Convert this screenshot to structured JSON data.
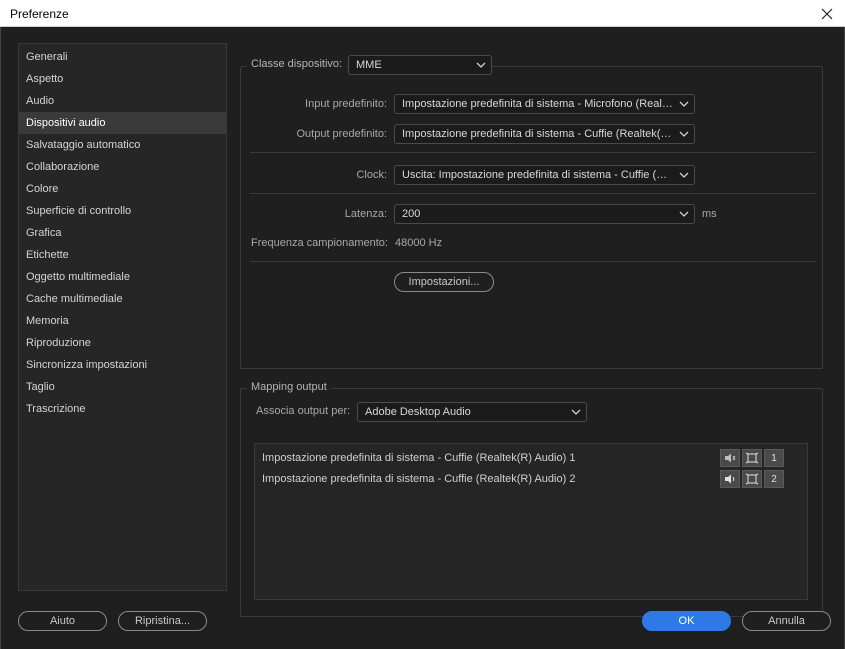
{
  "window": {
    "title": "Preferenze"
  },
  "sidebar": {
    "items": [
      {
        "label": "Generali"
      },
      {
        "label": "Aspetto"
      },
      {
        "label": "Audio"
      },
      {
        "label": "Dispositivi audio",
        "active": true
      },
      {
        "label": "Salvataggio automatico"
      },
      {
        "label": "Collaborazione"
      },
      {
        "label": "Colore"
      },
      {
        "label": "Superficie di controllo"
      },
      {
        "label": "Grafica"
      },
      {
        "label": "Etichette"
      },
      {
        "label": "Oggetto multimediale"
      },
      {
        "label": "Cache multimediale"
      },
      {
        "label": "Memoria"
      },
      {
        "label": "Riproduzione"
      },
      {
        "label": "Sincronizza impostazioni"
      },
      {
        "label": "Taglio"
      },
      {
        "label": "Trascrizione"
      }
    ]
  },
  "device": {
    "class_label": "Classe dispositivo:",
    "class_value": "MME",
    "input_label": "Input predefinito:",
    "input_value": "Impostazione predefinita di sistema - Microfono (Realtek(R) Audio)",
    "output_label": "Output predefinito:",
    "output_value": "Impostazione predefinita di sistema - Cuffie (Realtek(R) Audio)",
    "clock_label": "Clock:",
    "clock_value": "Uscita: Impostazione predefinita di sistema - Cuffie (Realtek(R) Audio)",
    "latency_label": "Latenza:",
    "latency_value": "200",
    "latency_unit": "ms",
    "sample_rate_label": "Frequenza campionamento:",
    "sample_rate_value": "48000 Hz",
    "settings_button": "Impostazioni..."
  },
  "mapping": {
    "group_label": "Mapping output",
    "map_label": "Associa output per:",
    "map_value": "Adobe Desktop Audio",
    "rows": [
      {
        "label": "Impostazione predefinita di sistema - Cuffie (Realtek(R) Audio) 1",
        "channel": "1",
        "icon": "speaker-muted-icon"
      },
      {
        "label": "Impostazione predefinita di sistema - Cuffie (Realtek(R) Audio) 2",
        "channel": "2",
        "icon": "speaker-icon"
      }
    ]
  },
  "footer": {
    "help": "Aiuto",
    "reset": "Ripristina...",
    "ok": "OK",
    "cancel": "Annulla"
  },
  "colors": {
    "accent": "#2d7ae6",
    "background": "#1f1f1f",
    "panel": "#262626"
  }
}
